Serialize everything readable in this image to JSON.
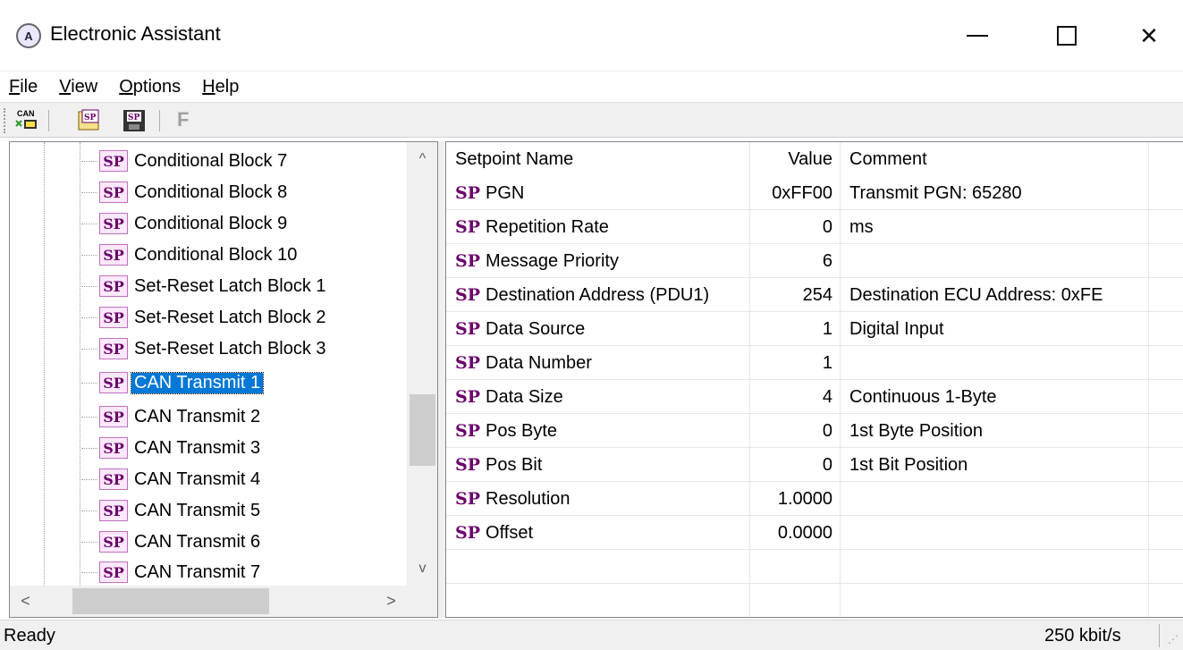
{
  "window": {
    "title": "Electronic Assistant",
    "icon": "app-logo-icon",
    "minimize": "minimize-icon",
    "maximize": "maximize-icon",
    "close": "close-icon",
    "close_glyph": "✕"
  },
  "menu": [
    {
      "key": "F",
      "rest": "ile"
    },
    {
      "key": "V",
      "rest": "iew"
    },
    {
      "key": "O",
      "rest": "ptions"
    },
    {
      "key": "H",
      "rest": "elp"
    }
  ],
  "toolbar": {
    "can_label": "CAN",
    "sp_label": "SP",
    "f_label": "F"
  },
  "tree": {
    "sp_icon": "SP",
    "items": [
      {
        "label": "Conditional Block 7"
      },
      {
        "label": "Conditional Block 8"
      },
      {
        "label": "Conditional Block 9"
      },
      {
        "label": "Conditional Block 10"
      },
      {
        "label": "Set-Reset Latch Block 1"
      },
      {
        "label": "Set-Reset Latch Block 2"
      },
      {
        "label": "Set-Reset Latch Block 3"
      },
      {
        "label": "CAN Transmit 1",
        "selected": true
      },
      {
        "label": "CAN Transmit 2"
      },
      {
        "label": "CAN Transmit 3"
      },
      {
        "label": "CAN Transmit 4"
      },
      {
        "label": "CAN Transmit 5"
      },
      {
        "label": "CAN Transmit 6"
      },
      {
        "label": "CAN Transmit 7"
      }
    ],
    "scroll": {
      "up": "^",
      "down": "v",
      "left": "<",
      "right": ">"
    }
  },
  "setpoints": {
    "columns": {
      "name": "Setpoint Name",
      "value": "Value",
      "comment": "Comment"
    },
    "tag": "SP",
    "rows": [
      {
        "name": "PGN",
        "value": "0xFF00",
        "comment": "Transmit PGN: 65280"
      },
      {
        "name": "Repetition Rate",
        "value": "0",
        "comment": "ms"
      },
      {
        "name": "Message Priority",
        "value": "6",
        "comment": ""
      },
      {
        "name": "Destination Address (PDU1)",
        "value": "254",
        "comment": "Destination ECU Address: 0xFE"
      },
      {
        "name": "Data Source",
        "value": "1",
        "comment": "Digital Input"
      },
      {
        "name": "Data Number",
        "value": "1",
        "comment": ""
      },
      {
        "name": "Data Size",
        "value": "4",
        "comment": "Continuous 1-Byte"
      },
      {
        "name": "Pos Byte",
        "value": "0",
        "comment": "1st Byte Position"
      },
      {
        "name": "Pos Bit",
        "value": "0",
        "comment": "1st Bit Position"
      },
      {
        "name": "Resolution",
        "value": "1.0000",
        "comment": ""
      },
      {
        "name": "Offset",
        "value": "0.0000",
        "comment": ""
      }
    ]
  },
  "status": {
    "text": "Ready",
    "rate": "250 kbit/s",
    "grip": "⋰"
  },
  "colors": {
    "selection": "#0078d7",
    "sp_purple": "#6a006a"
  }
}
